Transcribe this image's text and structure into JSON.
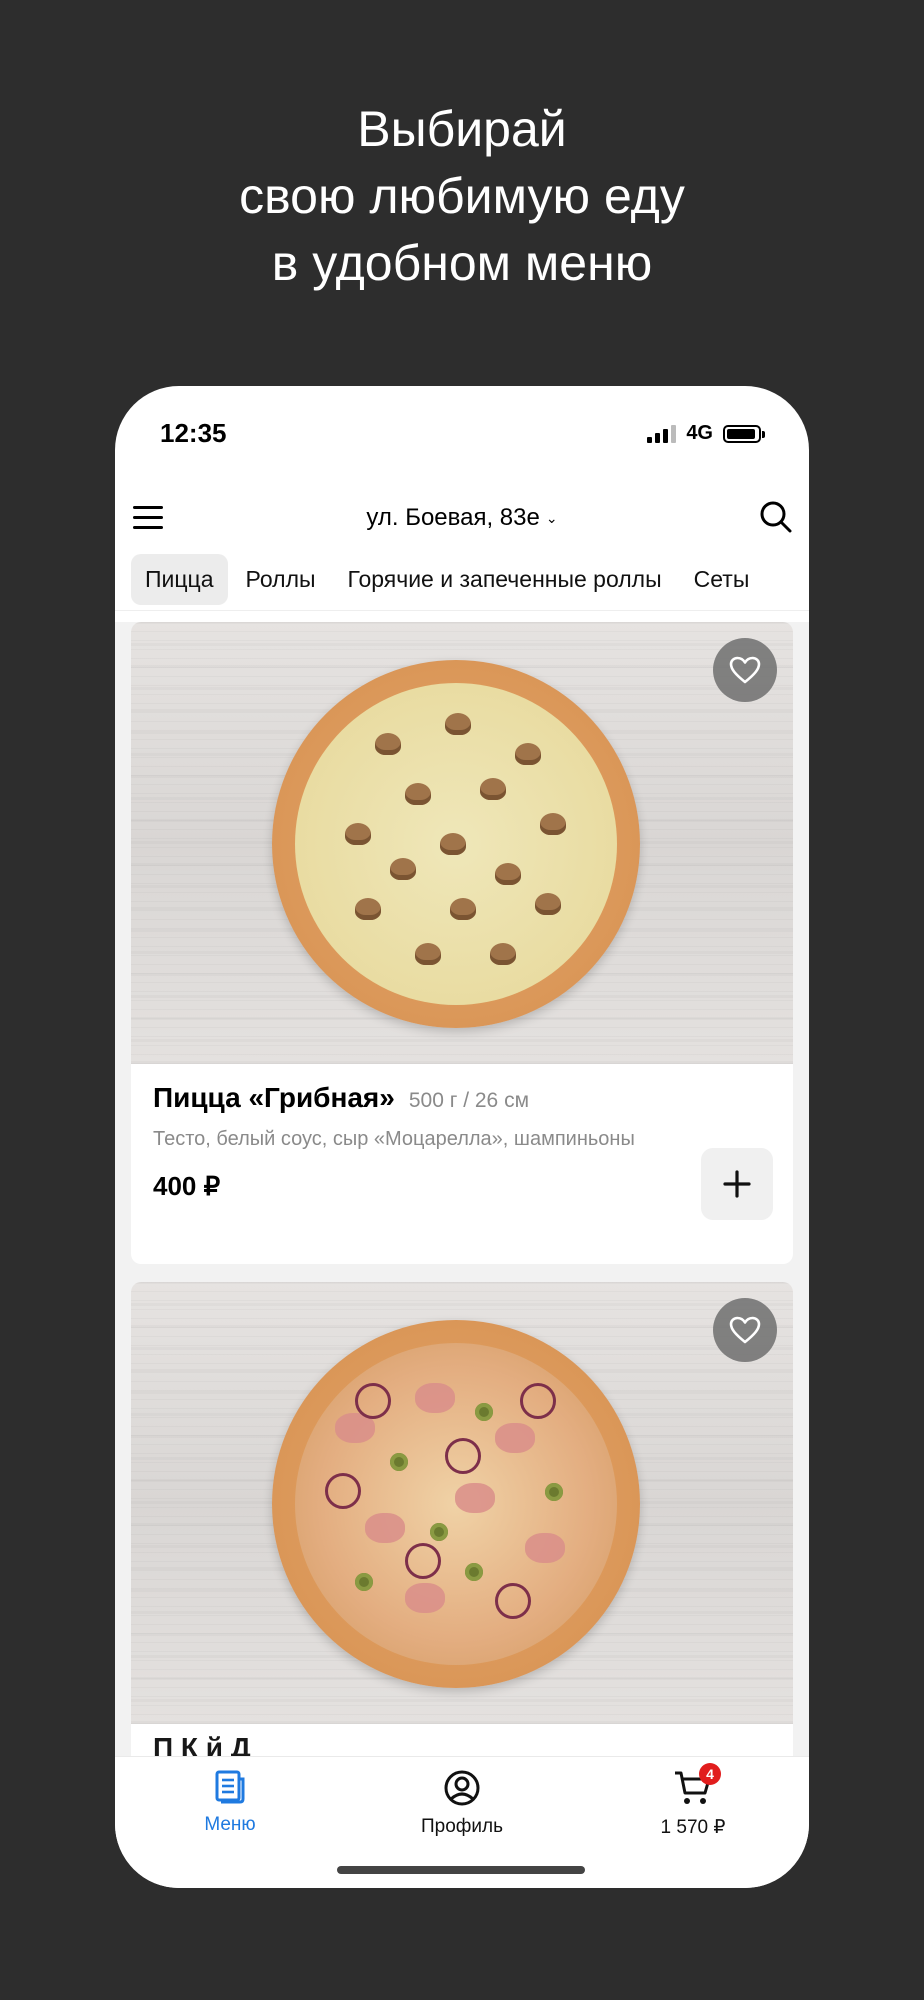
{
  "promo": {
    "line1": "Выбирай",
    "line2": "свою любимую еду",
    "line3": "в удобном меню"
  },
  "status_bar": {
    "time": "12:35",
    "network": "4G"
  },
  "header": {
    "address": "ул. Боевая, 83е"
  },
  "tabs": [
    {
      "label": "Пицца",
      "active": true
    },
    {
      "label": "Роллы",
      "active": false
    },
    {
      "label": "Горячие и запеченные роллы",
      "active": false
    },
    {
      "label": "Сеты",
      "active": false
    }
  ],
  "products": [
    {
      "title": "Пицца «Грибная»",
      "weight": "500 г / 26 см",
      "description": "Тесто, белый соус, сыр «Моцарелла», шампиньоны",
      "price": "400 ₽"
    },
    {
      "title_peek": "П   К          й Д"
    }
  ],
  "bottom_nav": {
    "menu_label": "Меню",
    "profile_label": "Профиль",
    "cart_label": "1 570 ₽",
    "cart_badge": "4"
  },
  "colors": {
    "accent": "#1f7ae0",
    "badge": "#e11d1d",
    "background": "#2d2d2d"
  }
}
